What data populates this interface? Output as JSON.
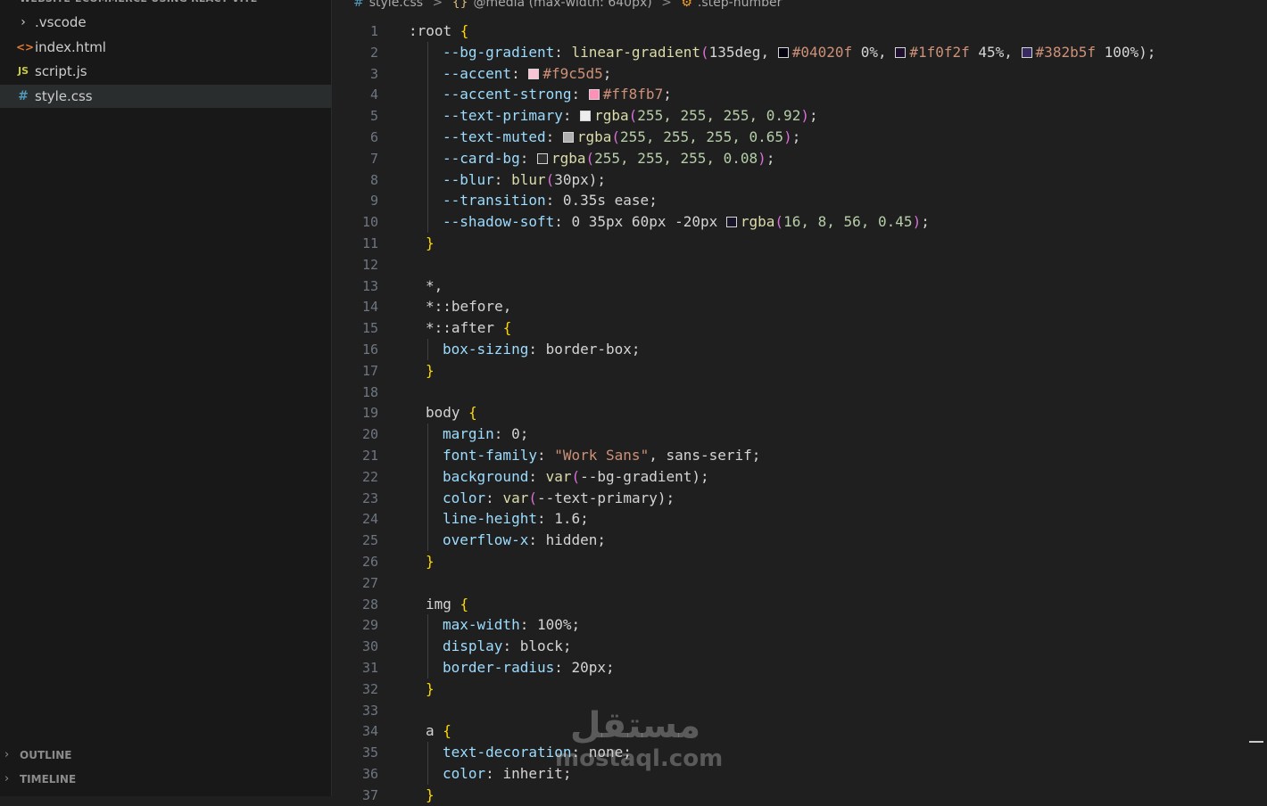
{
  "explorer": {
    "header": "WEBSITE-ECOMMERCE USING REACT VITE",
    "items": [
      {
        "label": ".vscode",
        "icon": "chevron-right-icon",
        "glyph": "›"
      },
      {
        "label": "index.html",
        "icon": "html-file-icon",
        "glyph": "<>"
      },
      {
        "label": "script.js",
        "icon": "js-file-icon",
        "glyph": "JS"
      },
      {
        "label": "style.css",
        "icon": "css-file-icon",
        "glyph": "#"
      }
    ],
    "panels": [
      {
        "label": "OUTLINE",
        "glyph": "›"
      },
      {
        "label": "TIMELINE",
        "glyph": "›"
      }
    ]
  },
  "breadcrumb": {
    "hash": "#",
    "file": "style.css",
    "sep": ">",
    "media_braces": "{}",
    "media": "@media (max-width: 640px)",
    "selector_icon": "selector-icon",
    "selector_glyph": "⚙",
    "selector": ".step-number"
  },
  "colors": {
    "accent": "#f9c5d5",
    "accent_strong": "#ff8fb7",
    "bg1": "#04020f",
    "bg2": "#1f0f2f",
    "bg3": "#382b5f"
  },
  "code_lines": [
    {
      "n": "1",
      "t": ":root {"
    },
    {
      "n": "2",
      "t": "--bg-gradient: linear-gradient(135deg, #04020f 0%, #1f0f2f 45%, #382b5f 100%);"
    },
    {
      "n": "3",
      "t": "--accent: #f9c5d5;"
    },
    {
      "n": "4",
      "t": "--accent-strong: #ff8fb7;"
    },
    {
      "n": "5",
      "t": "--text-primary: rgba(255, 255, 255, 0.92);"
    },
    {
      "n": "6",
      "t": "--text-muted: rgba(255, 255, 255, 0.65);"
    },
    {
      "n": "7",
      "t": "--card-bg: rgba(255, 255, 255, 0.08);"
    },
    {
      "n": "8",
      "t": "--blur: blur(30px);"
    },
    {
      "n": "9",
      "t": "--transition: 0.35s ease;"
    },
    {
      "n": "10",
      "t": "--shadow-soft: 0 35px 60px -20px rgba(16, 8, 56, 0.45);"
    },
    {
      "n": "11",
      "t": "}"
    },
    {
      "n": "12",
      "t": ""
    },
    {
      "n": "13",
      "t": "*,"
    },
    {
      "n": "14",
      "t": "*::before,"
    },
    {
      "n": "15",
      "t": "*::after {"
    },
    {
      "n": "16",
      "t": "box-sizing: border-box;"
    },
    {
      "n": "17",
      "t": "}"
    },
    {
      "n": "18",
      "t": ""
    },
    {
      "n": "19",
      "t": "body {"
    },
    {
      "n": "20",
      "t": "margin: 0;"
    },
    {
      "n": "21",
      "t": "font-family: \"Work Sans\", sans-serif;"
    },
    {
      "n": "22",
      "t": "background: var(--bg-gradient);"
    },
    {
      "n": "23",
      "t": "color: var(--text-primary);"
    },
    {
      "n": "24",
      "t": "line-height: 1.6;"
    },
    {
      "n": "25",
      "t": "overflow-x: hidden;"
    },
    {
      "n": "26",
      "t": "}"
    },
    {
      "n": "27",
      "t": ""
    },
    {
      "n": "28",
      "t": "img {"
    },
    {
      "n": "29",
      "t": "max-width: 100%;"
    },
    {
      "n": "30",
      "t": "display: block;"
    },
    {
      "n": "31",
      "t": "border-radius: 20px;"
    },
    {
      "n": "32",
      "t": "}"
    },
    {
      "n": "33",
      "t": ""
    },
    {
      "n": "34",
      "t": "a {"
    },
    {
      "n": "35",
      "t": "text-decoration: none;"
    },
    {
      "n": "36",
      "t": "color: inherit;"
    },
    {
      "n": "37",
      "t": "}"
    }
  ],
  "watermark": {
    "arabic": "مستقل",
    "latin": "mostaql.com"
  }
}
